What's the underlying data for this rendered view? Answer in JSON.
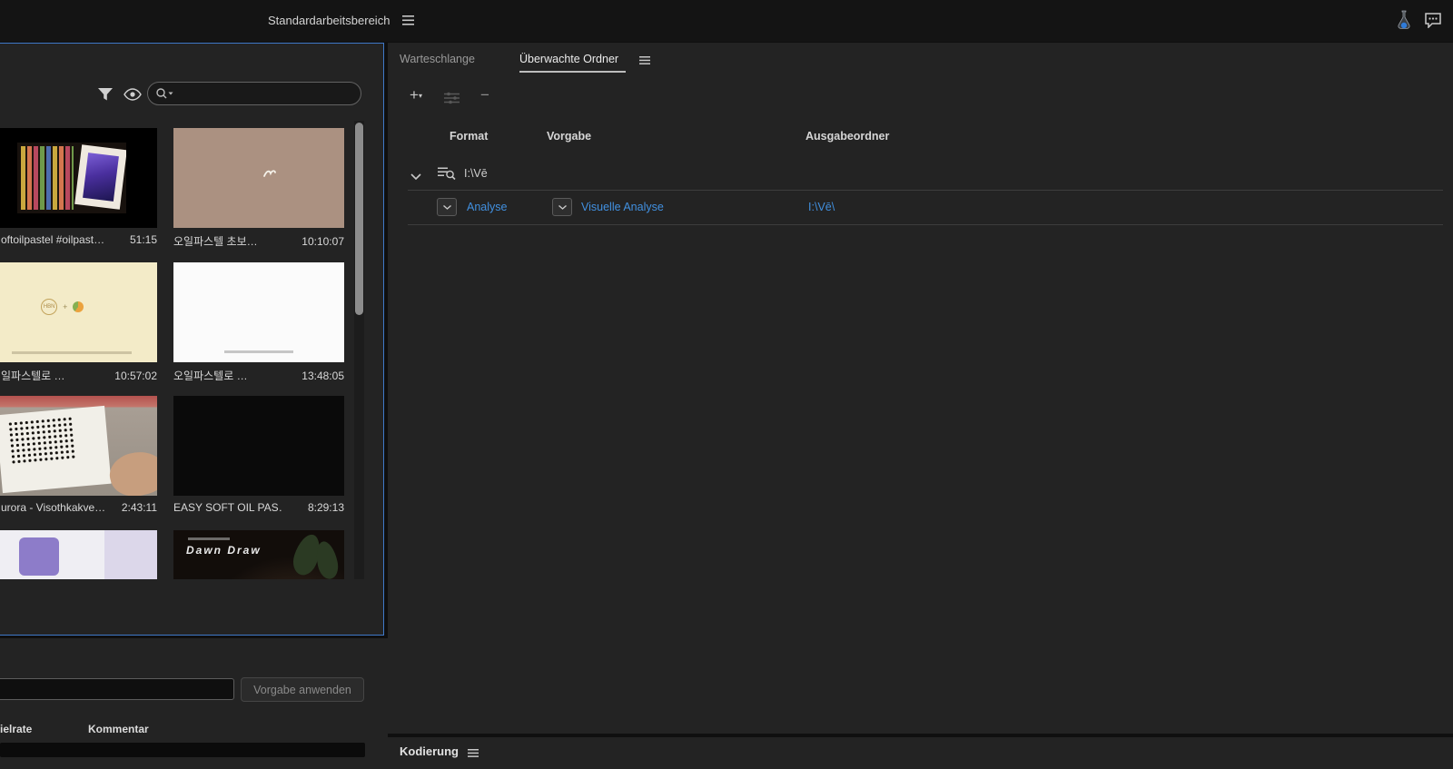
{
  "titlebar": {
    "workspace": "Standardarbeitsbereich"
  },
  "media_browser": {
    "search_placeholder": "",
    "tiles": [
      {
        "label": "oftoilpastel #oilpast…",
        "duration": "51:15"
      },
      {
        "label": "오일파스텔 초보…",
        "duration": "10:10:07"
      },
      {
        "label": "일파스텔로 …",
        "duration": "10:57:02"
      },
      {
        "label": "오일파스텔로 …",
        "duration": "13:48:05"
      },
      {
        "label": "urora - Visothkakve…",
        "duration": "2:43:11"
      },
      {
        "label": "EASY SOFT OIL PAS…",
        "duration": "8:29:13"
      },
      {
        "label": "",
        "duration": ""
      },
      {
        "label": "",
        "duration": "",
        "thumb_text": "Dawn Draw"
      }
    ]
  },
  "left_bottom": {
    "apply_button": "Vorgabe anwenden",
    "columns": [
      "ielrate",
      "Kommentar"
    ]
  },
  "watch_folders": {
    "tabs": [
      {
        "label": "Warteschlange",
        "active": false
      },
      {
        "label": "Überwachte Ordner",
        "active": true
      }
    ],
    "columns": [
      "Format",
      "Vorgabe",
      "Ausgabeordner"
    ],
    "folder_path": "I:\\Vē",
    "rows": [
      {
        "format": "Analyse",
        "preset": "Visuelle Analyse",
        "output": "I:\\Vē\\"
      }
    ]
  },
  "encoding": {
    "title": "Kodierung"
  },
  "colors": {
    "accent_blue": "#4190e0",
    "focus_border": "#3f79c9",
    "panel_bg": "#232323"
  }
}
